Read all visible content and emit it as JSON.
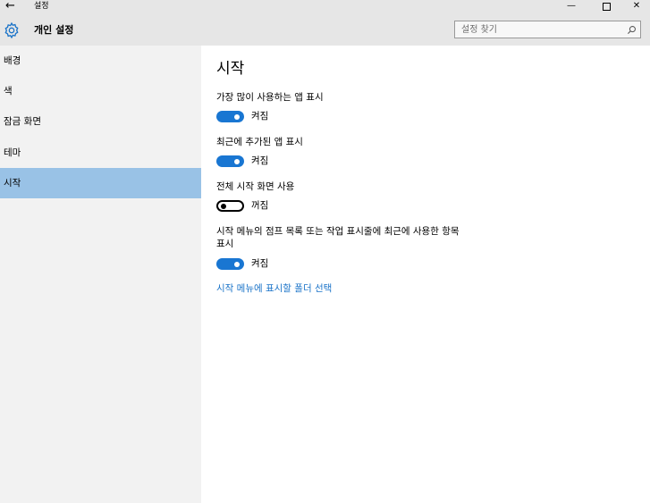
{
  "window": {
    "title": "설정",
    "back_glyph": "←",
    "minimize_glyph": "—",
    "close_glyph": "✕"
  },
  "header": {
    "title": "개인 설정",
    "icon": "gear-icon",
    "accent_color": "#1a73c8"
  },
  "search": {
    "placeholder": "설정 찾기",
    "icon": "search-icon"
  },
  "sidebar": {
    "items": [
      {
        "label": "배경",
        "active": false
      },
      {
        "label": "색",
        "active": false
      },
      {
        "label": "잠금 화면",
        "active": false
      },
      {
        "label": "테마",
        "active": false
      },
      {
        "label": "시작",
        "active": true
      }
    ],
    "active_color": "#99c2e6"
  },
  "main": {
    "title": "시작",
    "settings": [
      {
        "label": "가장 많이 사용하는 앱 표시",
        "state": "켜짐",
        "on": true
      },
      {
        "label": "최근에 추가된 앱 표시",
        "state": "켜짐",
        "on": true
      },
      {
        "label": "전체 시작 화면 사용",
        "state": "꺼짐",
        "on": false
      },
      {
        "label_line1": "시작 메뉴의 점프 목록 또는 작업 표시줄에 최근에 사용한 항목",
        "label_line2": "표시",
        "state": "켜짐",
        "on": true
      }
    ],
    "link": "시작 메뉴에 표시할 폴더 선택",
    "toggle_on_color": "#1976d2"
  }
}
